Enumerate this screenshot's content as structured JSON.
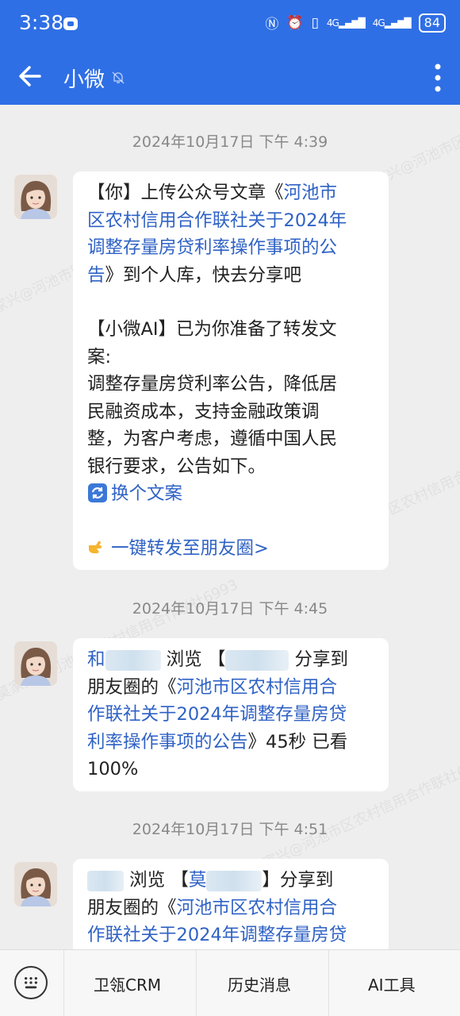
{
  "status_bar": {
    "time": "3:38",
    "icons": [
      "nfc-icon",
      "alarm-icon",
      "vibrate-icon",
      "signal-icon",
      "signal-icon"
    ],
    "net1": "4G",
    "net2": "4G",
    "battery": "84"
  },
  "header": {
    "back_icon": "back-arrow-icon",
    "title": "小微",
    "mute_icon": "mute-icon",
    "more_icon": "more-vert-icon"
  },
  "messages": [
    {
      "timestamp": "2024年10月17日  下午 4:39",
      "line1_pre": "【你】上传公众号文章《",
      "line1_link": "河池市",
      "line2_link": "区农村信用合作联社关于2024年",
      "line3_link": "调整存量房贷利率操作事项的公",
      "line4_link": "告",
      "line4_post": "》到个人库，快去分享吧",
      "ai_line1": "【小微AI】已为你准备了转发文",
      "ai_line2": "案:",
      "copy_line1": "调整存量房贷利率公告，降低居",
      "copy_line2": "民融资成本，支持金融政策调",
      "copy_line3": "整，为客户考虑，遵循中国人民",
      "copy_line4": "银行要求，公告如下。",
      "change_copy": "换个文案",
      "forward": "一键转发至朋友圈>"
    },
    {
      "timestamp": "2024年10月17日  下午 4:45",
      "viewer_visible": "和",
      "browse": "浏览",
      "bracket_open": "【",
      "share_to": "分享到",
      "line2_pre": "朋友圈的《",
      "line2_link": "河池市区农村信用合",
      "line3_link": "作联社关于2024年调整存量房贷",
      "line4_link": "利率操作事项的公告",
      "line4_post": "》45秒 已看",
      "line5": "100%"
    },
    {
      "timestamp": "2024年10月17日  下午 4:51",
      "browse": "浏览",
      "bracket_open": "【",
      "sharer_visible": "莫",
      "bracket_close_share": "】分享到",
      "line2_pre": "朋友圈的《",
      "line2_link": "河池市区农村信用合",
      "line3_link": "作联社关于2024年调整存量房贷"
    }
  ],
  "watermarks": [
    "莫家兴@河池市区农村信用合作联社6993"
  ],
  "bottom_bar": {
    "keyboard_icon": "keyboard-icon",
    "tab1": "卫瓴CRM",
    "tab2": "历史消息",
    "tab3": "AI工具"
  },
  "colors": {
    "accent": "#2f6fe5",
    "link": "#2f62c5",
    "background": "#eeeeee"
  }
}
